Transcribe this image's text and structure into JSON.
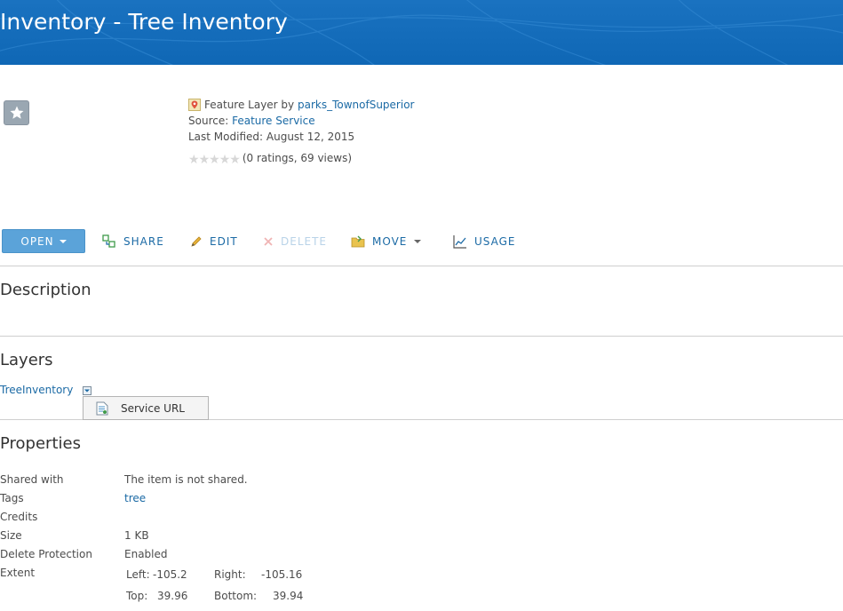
{
  "header": {
    "title": "Inventory - Tree Inventory"
  },
  "item": {
    "type_text": "Feature Layer by",
    "owner": "parks_TownofSuperior",
    "source_label": "Source:",
    "source_value": "Feature Service",
    "modified_label": "Last Modified:",
    "modified_value": "August 12, 2015",
    "ratings_text": "(0 ratings, 69 views)",
    "rating_stars": 0,
    "rating_max": 5
  },
  "toolbar": {
    "open_label": "OPEN",
    "share_label": "SHARE",
    "edit_label": "EDIT",
    "delete_label": "DELETE",
    "move_label": "MOVE",
    "usage_label": "USAGE"
  },
  "sections": {
    "description": "Description",
    "layers": "Layers",
    "properties": "Properties"
  },
  "layers": {
    "items": [
      {
        "name": "TreeInventory"
      }
    ],
    "dropdown_item": "Service URL"
  },
  "properties": {
    "rows": [
      {
        "key": "Shared with",
        "value": "The item is not shared.",
        "link": false
      },
      {
        "key": "Tags",
        "value": "tree",
        "link": true
      },
      {
        "key": "Credits",
        "value": "",
        "link": false
      },
      {
        "key": "Size",
        "value": "1 KB",
        "link": false
      },
      {
        "key": "Delete Protection",
        "value": "Enabled",
        "link": false
      },
      {
        "key": "Extent",
        "value": "",
        "link": false
      }
    ],
    "extent": {
      "left_label": "Left:",
      "left_value": "-105.2",
      "right_label": "Right:",
      "right_value": "-105.16",
      "top_label": "Top:",
      "top_value": "39.96",
      "bottom_label": "Bottom:",
      "bottom_value": "39.94"
    }
  },
  "colors": {
    "banner": "#1a72c0",
    "link": "#1b6aa5",
    "open_button": "#5ba3d9",
    "disabled": "#b9d3e8"
  },
  "icons": {
    "thumbnail": "star-icon",
    "type": "map-pin-icon",
    "share": "share-icon",
    "edit": "pencil-icon",
    "delete": "x-icon",
    "move": "folder-icon",
    "usage": "chart-icon",
    "service_url": "document-icon"
  }
}
